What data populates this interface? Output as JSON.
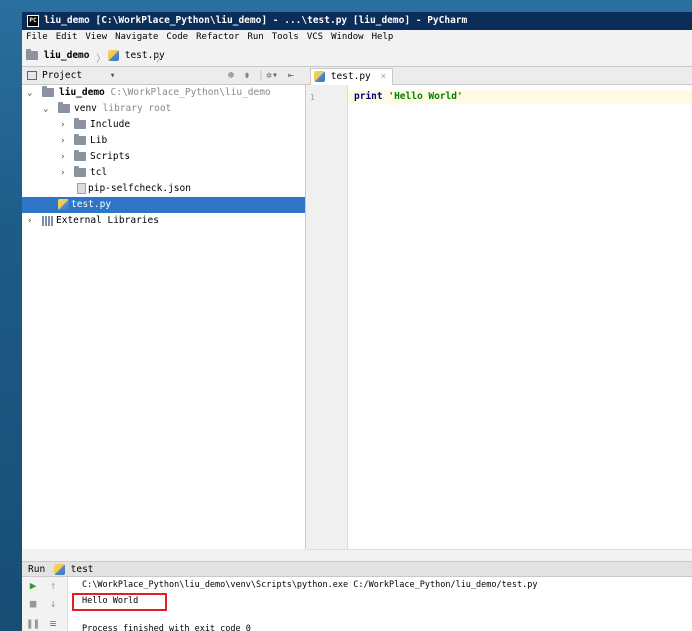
{
  "window": {
    "title": "liu_demo [C:\\WorkPlace_Python\\liu_demo] - ...\\test.py [liu_demo] - PyCharm",
    "app_icon": "PC"
  },
  "menu": [
    "File",
    "Edit",
    "View",
    "Navigate",
    "Code",
    "Refactor",
    "Run",
    "Tools",
    "VCS",
    "Window",
    "Help"
  ],
  "breadcrumb": {
    "project": "liu_demo",
    "file": "test.py"
  },
  "project_panel": {
    "title": "Project",
    "tree": [
      {
        "label": "liu_demo",
        "hint": "C:\\WorkPlace_Python\\liu_demo"
      },
      {
        "label": "venv",
        "hint": "library root"
      },
      {
        "label": "Include"
      },
      {
        "label": "Lib"
      },
      {
        "label": "Scripts"
      },
      {
        "label": "tcl"
      },
      {
        "label": "pip-selfcheck.json"
      },
      {
        "label": "test.py",
        "selected": true
      },
      {
        "label": "External Libraries"
      }
    ]
  },
  "editor": {
    "tab_label": "test.py",
    "line_number": "1",
    "code_keyword": "print",
    "code_string": "'Hello World'"
  },
  "run_panel": {
    "title_prefix": "Run",
    "config_name": "test",
    "command": "C:\\WorkPlace_Python\\liu_demo\\venv\\Scripts\\python.exe C:/WorkPlace_Python/liu_demo/test.py",
    "output": "Hello World",
    "exit_line": "Process finished with exit code 0"
  },
  "colors": {
    "accent_selection": "#2d76c7",
    "titlebar": "#0b2d5a",
    "highlight_box": "#e02020"
  }
}
